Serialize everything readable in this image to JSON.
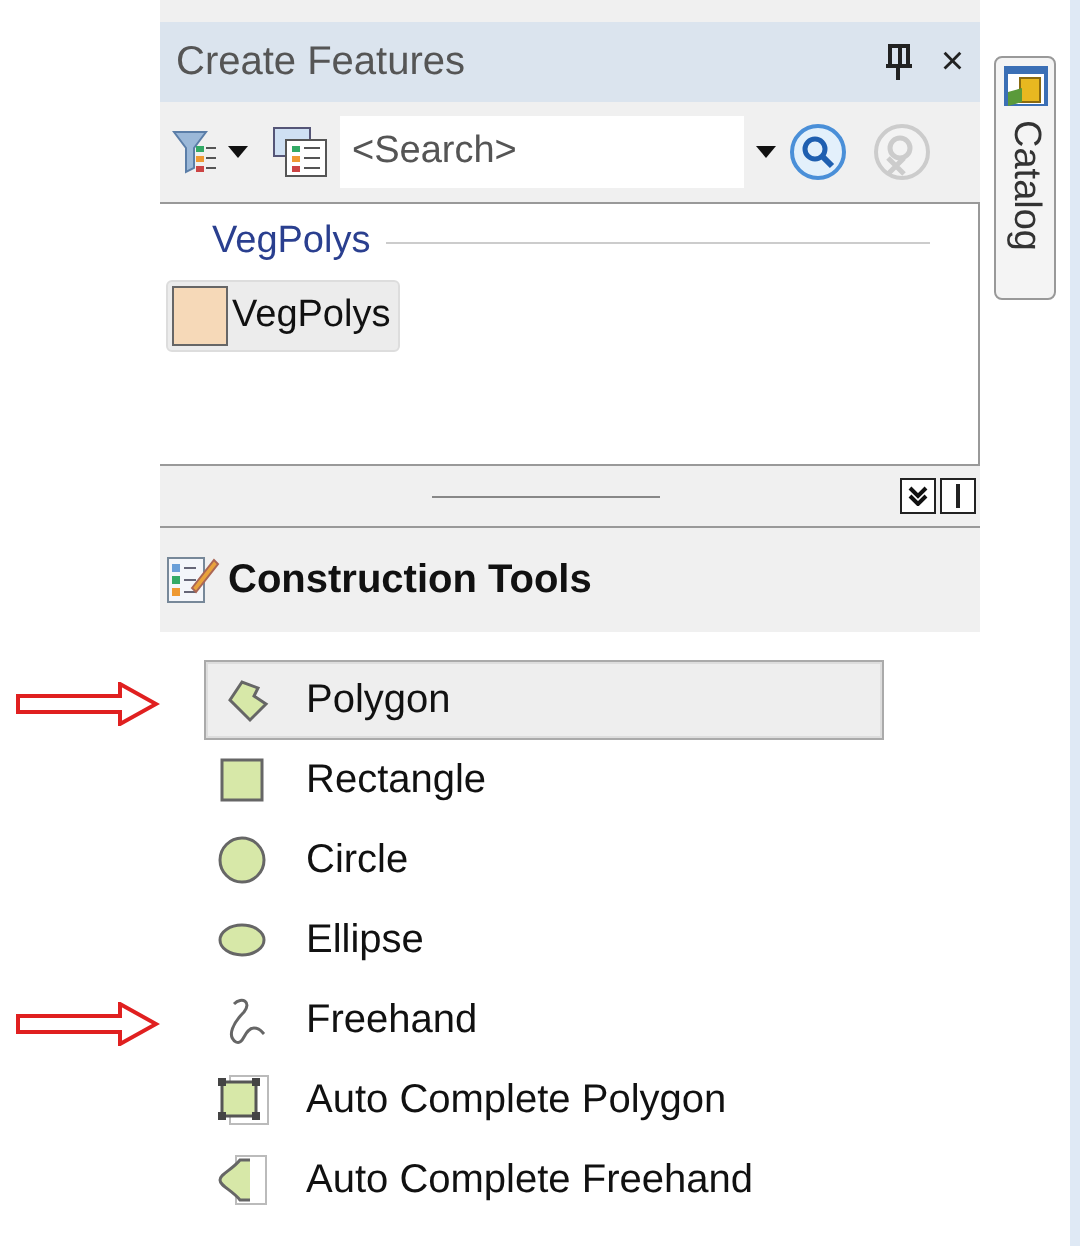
{
  "panel": {
    "title": "Create Features",
    "close": "×"
  },
  "toolbar": {
    "search": {
      "placeholder": "<Search>"
    }
  },
  "templates": {
    "group": "VegPolys",
    "items": [
      {
        "label": "VegPolys",
        "color": "#f6d9b8",
        "selected": true
      }
    ]
  },
  "construction": {
    "title": "Construction Tools",
    "tools": [
      {
        "label": "Polygon",
        "kind": "polygon",
        "selected": true,
        "marked": true
      },
      {
        "label": "Rectangle",
        "kind": "rectangle",
        "selected": false,
        "marked": false
      },
      {
        "label": "Circle",
        "kind": "circle",
        "selected": false,
        "marked": false
      },
      {
        "label": "Ellipse",
        "kind": "ellipse",
        "selected": false,
        "marked": false
      },
      {
        "label": "Freehand",
        "kind": "freehand",
        "selected": false,
        "marked": true
      },
      {
        "label": "Auto Complete Polygon",
        "kind": "autopolygon",
        "selected": false,
        "marked": false
      },
      {
        "label": "Auto Complete Freehand",
        "kind": "autofreehand",
        "selected": false,
        "marked": false
      }
    ]
  },
  "side_tab": {
    "label": "Catalog"
  }
}
